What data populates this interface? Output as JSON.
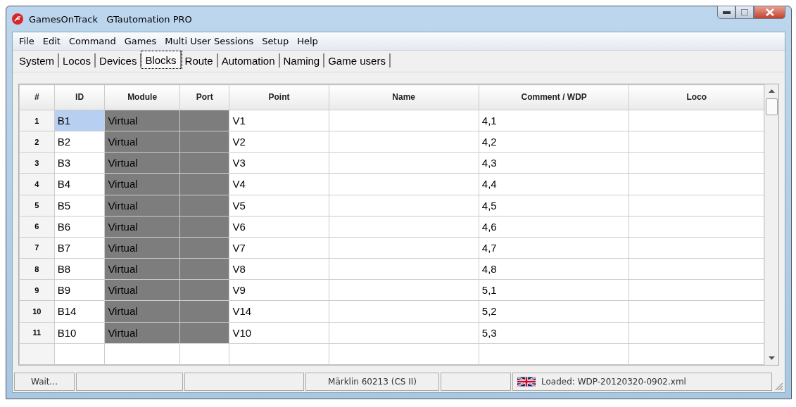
{
  "window": {
    "title": "GamesOnTrack   GTautomation PRO"
  },
  "menu": [
    "File",
    "Edit",
    "Command",
    "Games",
    "Multi User Sessions",
    "Setup",
    "Help"
  ],
  "tabs": [
    {
      "label": "System",
      "selected": false
    },
    {
      "label": "Locos",
      "selected": false
    },
    {
      "label": "Devices",
      "selected": false
    },
    {
      "label": "Blocks",
      "selected": true
    },
    {
      "label": "Route",
      "selected": false
    },
    {
      "label": "Automation",
      "selected": false
    },
    {
      "label": "Naming",
      "selected": false
    },
    {
      "label": "Game users",
      "selected": false
    }
  ],
  "table": {
    "columns": [
      "#",
      "ID",
      "Module",
      "Port",
      "Point",
      "Name",
      "Comment / WDP",
      "Loco"
    ],
    "rows": [
      {
        "num": "1",
        "id": "B1",
        "module": "Virtual",
        "point": "V1",
        "comment": "4,1",
        "selected": true,
        "module_locked": true
      },
      {
        "num": "2",
        "id": "B2",
        "module": "Virtual",
        "point": "V2",
        "comment": "4,2",
        "selected": false,
        "module_locked": true
      },
      {
        "num": "3",
        "id": "B3",
        "module": "Virtual",
        "point": "V3",
        "comment": "4,3",
        "selected": false,
        "module_locked": true
      },
      {
        "num": "4",
        "id": "B4",
        "module": "Virtual",
        "point": "V4",
        "comment": "4,4",
        "selected": false,
        "module_locked": true
      },
      {
        "num": "5",
        "id": "B5",
        "module": "Virtual",
        "point": "V5",
        "comment": "4,5",
        "selected": false,
        "module_locked": true
      },
      {
        "num": "6",
        "id": "B6",
        "module": "Virtual",
        "point": "V6",
        "comment": "4,6",
        "selected": false,
        "module_locked": true
      },
      {
        "num": "7",
        "id": "B7",
        "module": "Virtual",
        "point": "V7",
        "comment": "4,7",
        "selected": false,
        "module_locked": true
      },
      {
        "num": "8",
        "id": "B8",
        "module": "Virtual",
        "point": "V8",
        "comment": "4,8",
        "selected": false,
        "module_locked": true
      },
      {
        "num": "9",
        "id": "B9",
        "module": "Virtual",
        "point": "V9",
        "comment": "5,1",
        "selected": false,
        "module_locked": true
      },
      {
        "num": "10",
        "id": "B14",
        "module": "Virtual",
        "point": "V14",
        "comment": "5,2",
        "selected": false,
        "module_locked": true
      },
      {
        "num": "11",
        "id": "B10",
        "module": "Virtual",
        "point": "V10",
        "comment": "5,3",
        "selected": false,
        "module_locked": true
      }
    ]
  },
  "status_bar": {
    "status": "Wait...",
    "device": "Märklin 60213 (CS II)",
    "file": "Loaded: WDP-20120320-0902.xml"
  }
}
